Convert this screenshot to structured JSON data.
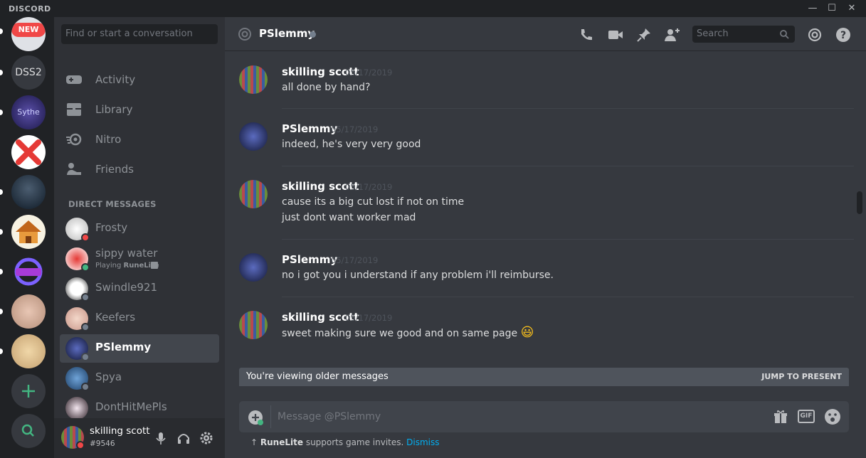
{
  "app": {
    "logo": "DISCORD"
  },
  "window_controls": {
    "minimize": "—",
    "maximize": "☐",
    "close": "✕"
  },
  "guilds": [
    {
      "label": "NEW",
      "kind": "badge"
    },
    {
      "label": "DSS2",
      "kind": "text"
    },
    {
      "label": "Sythe",
      "kind": "image"
    },
    {
      "label": "",
      "kind": "image"
    },
    {
      "label": "",
      "kind": "image"
    },
    {
      "label": "",
      "kind": "image"
    },
    {
      "label": "",
      "kind": "image"
    },
    {
      "label": "",
      "kind": "image"
    },
    {
      "label": "",
      "kind": "image"
    }
  ],
  "search": {
    "placeholder": "Find or start a conversation"
  },
  "nav": [
    {
      "label": "Activity",
      "icon": "gamepad-icon"
    },
    {
      "label": "Library",
      "icon": "library-icon"
    },
    {
      "label": "Nitro",
      "icon": "nitro-icon"
    },
    {
      "label": "Friends",
      "icon": "friends-icon"
    }
  ],
  "dm_header": "DIRECT MESSAGES",
  "dms": [
    {
      "name": "Frosty",
      "status": "dnd"
    },
    {
      "name": "sippy water",
      "status": "online",
      "activity_prefix": "Playing ",
      "activity_game": "RuneLite"
    },
    {
      "name": "Swindle921",
      "status": "offline"
    },
    {
      "name": "Keefers",
      "status": "offline"
    },
    {
      "name": "PSlemmy",
      "status": "offline",
      "active": true
    },
    {
      "name": "Spya",
      "status": "offline"
    },
    {
      "name": "DontHitMePls",
      "status": "offline"
    }
  ],
  "user": {
    "name": "skilling scott",
    "tag": "#9546"
  },
  "channel": {
    "name": "PSlemmy"
  },
  "header_search": {
    "placeholder": "Search"
  },
  "messages": [
    {
      "author": "skilling scott",
      "time": "05/17/2019",
      "lines": [
        "all done by hand?"
      ],
      "emoji": ""
    },
    {
      "author": "PSlemmy",
      "time": "05/17/2019",
      "lines": [
        "indeed, he's very very good"
      ],
      "emoji": ""
    },
    {
      "author": "skilling scott",
      "time": "05/17/2019",
      "lines": [
        "cause its a big cut lost if not on time",
        "just dont want worker mad"
      ],
      "emoji": ""
    },
    {
      "author": "PSlemmy",
      "time": "05/17/2019",
      "lines": [
        "no i got you i understand if any problem i'll reimburse."
      ],
      "emoji": ""
    },
    {
      "author": "skilling scott",
      "time": "05/17/2019",
      "lines": [
        "sweet making sure we good and on same page"
      ],
      "emoji": "😃"
    }
  ],
  "older_bar": {
    "text": "You're viewing older messages",
    "jump": "JUMP TO PRESENT"
  },
  "composer": {
    "placeholder": "Message @PSlemmy",
    "gif": "GIF"
  },
  "notice": {
    "arrow": "↑",
    "app": "RuneLite",
    "text": " supports game invites. ",
    "dismiss": "Dismiss"
  },
  "colors": {
    "online": "#43b581",
    "dnd": "#f04747",
    "offline": "#747f8d",
    "accent": "#7289da",
    "link": "#00b0f4",
    "new_badge": "#f04747"
  }
}
